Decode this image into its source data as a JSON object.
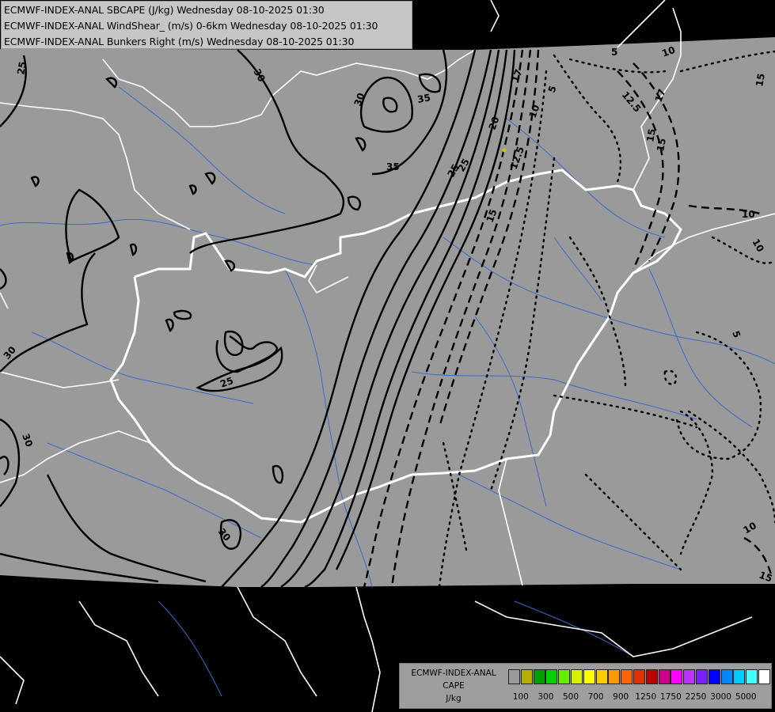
{
  "header": {
    "lines": [
      "ECMWF-INDEX-ANAL SBCAPE (J/kg) Wednesday 08-10-2025 01:30",
      "ECMWF-INDEX-ANAL WindShear_ (m/s) 0-6km Wednesday 08-10-2025 01:30",
      "ECMWF-INDEX-ANAL Bunkers Right (m/s) Wednesday 08-10-2025 01:30"
    ]
  },
  "legend": {
    "title_line1": "ECMWF-INDEX-ANAL",
    "title_line2": "CAPE",
    "title_line3": "J/kg",
    "swatch_colors": [
      "#9a9a9a",
      "#b5b000",
      "#009f00",
      "#00d000",
      "#66ee00",
      "#d8f000",
      "#ffff00",
      "#ffcc00",
      "#ff9900",
      "#ff6600",
      "#e03000",
      "#bb0000",
      "#cc0088",
      "#ff00ff",
      "#bb33ff",
      "#7722ff",
      "#0000ff",
      "#0088ff",
      "#00ccff",
      "#44ffff",
      "#ffffff"
    ],
    "tick_labels": [
      "100",
      "300",
      "500",
      "700",
      "900",
      "1250",
      "1750",
      "2250",
      "3000",
      "5000"
    ]
  },
  "map": {
    "cape_labels": [
      "25",
      "30",
      "30",
      "35",
      "35",
      "30",
      "25",
      "30",
      "25",
      "30",
      "25",
      "30",
      "20",
      "17",
      "15"
    ],
    "shear_labels": [
      "12.5",
      "10",
      "12.5",
      "15",
      "15",
      "10",
      "10",
      "15"
    ],
    "bunkers_labels": [
      "5",
      "5",
      "10",
      "15",
      "17",
      "10",
      "5",
      "10"
    ],
    "colors": {
      "domain_fill": "#9a9a9a",
      "outside": "#000000",
      "border": "#ffffff",
      "river": "#3a6ac8",
      "contour": "#000000"
    }
  }
}
